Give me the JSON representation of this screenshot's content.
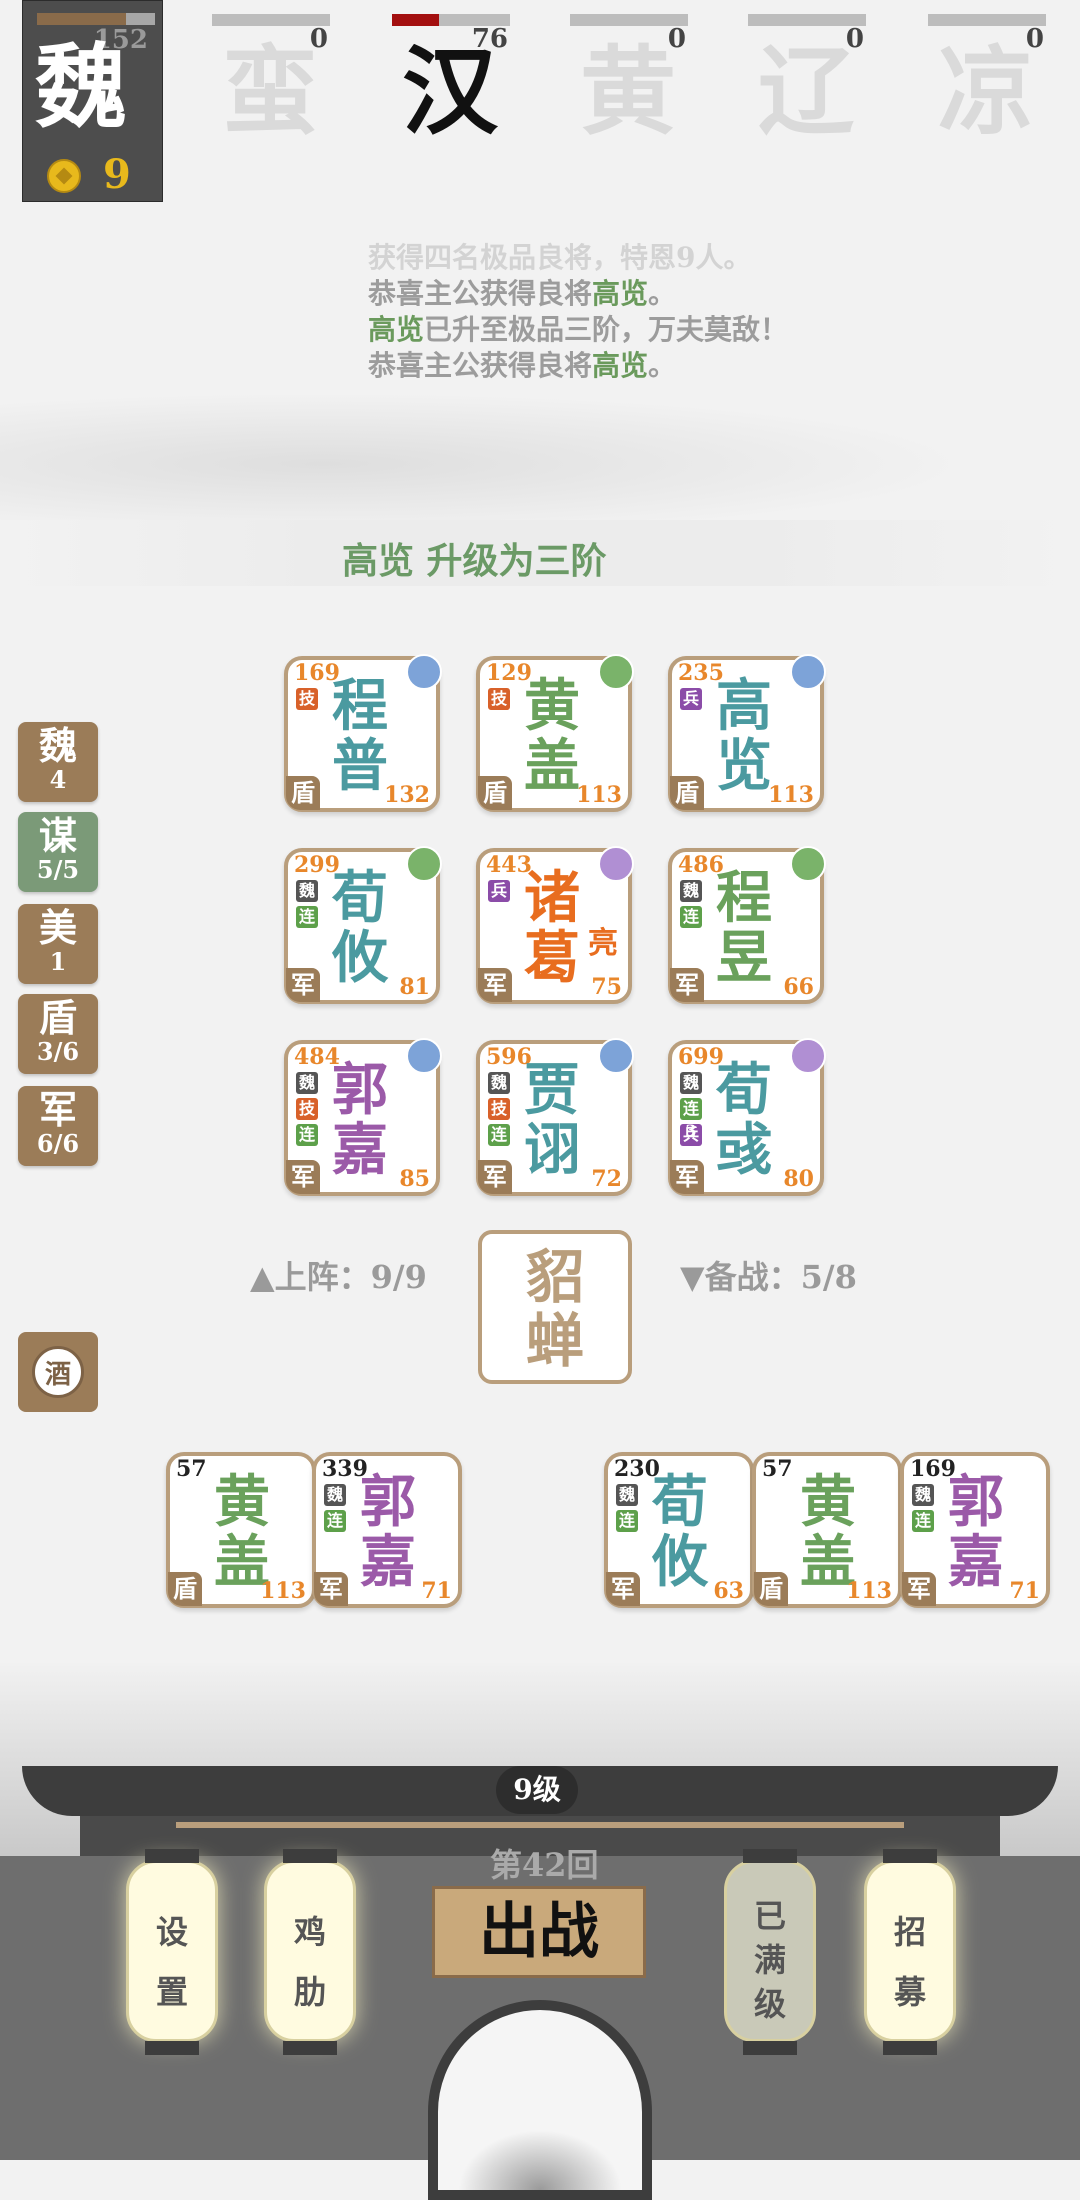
{
  "player": {
    "faction": "魏",
    "hp": "152",
    "gold": "9",
    "hp_fraction": 0.75
  },
  "rivals": [
    {
      "char": "蛮",
      "count": "0",
      "fill": 0
    },
    {
      "char": "汉",
      "count": "76",
      "fill": 0.4
    },
    {
      "char": "黄",
      "count": "0",
      "fill": 0
    },
    {
      "char": "辽",
      "count": "0",
      "fill": 0
    },
    {
      "char": "凉",
      "count": "0",
      "fill": 0
    }
  ],
  "log": {
    "line0": "获得四名极品良将，特恩9人。",
    "line1_a": "恭喜主公获得良将",
    "line1_b": "高览",
    "line1_c": "。",
    "line2_a": "高览",
    "line2_b": "已升至极品三阶，万夫莫敌！",
    "line3_a": "恭喜主公获得良将",
    "line3_b": "高览",
    "line3_c": "。"
  },
  "promotion": "高览 升级为三阶",
  "side_tabs": [
    {
      "title": "魏",
      "count": "4"
    },
    {
      "title": "谋",
      "count": "5/5"
    },
    {
      "title": "美",
      "count": "1"
    },
    {
      "title": "盾",
      "count": "3/6"
    },
    {
      "title": "军",
      "count": "6/6"
    }
  ],
  "wine_label": "酒",
  "formation": [
    {
      "n1": "程",
      "n2": "普",
      "lv": "169",
      "cls": "盾",
      "pow": "132",
      "color": "teal",
      "weapon": "blue",
      "tags": [
        "技"
      ]
    },
    {
      "n1": "黄",
      "n2": "盖",
      "lv": "129",
      "cls": "盾",
      "pow": "113",
      "color": "green",
      "weapon": "green",
      "tags": [
        "技"
      ]
    },
    {
      "n1": "高",
      "n2": "览",
      "lv": "235",
      "cls": "盾",
      "pow": "113",
      "color": "teal",
      "weapon": "blue",
      "tags": [
        "兵"
      ]
    },
    {
      "n1": "荀",
      "n2": "攸",
      "lv": "299",
      "cls": "军",
      "pow": "81",
      "color": "teal",
      "weapon": "green",
      "tags": [
        "魏",
        "连2"
      ]
    },
    {
      "n1": "诸",
      "n2": "葛",
      "sub": "亮",
      "lv": "443",
      "cls": "军",
      "pow": "75",
      "color": "orange",
      "weapon": "purple",
      "tags": [
        "兵"
      ]
    },
    {
      "n1": "程",
      "n2": "昱",
      "lv": "486",
      "cls": "军",
      "pow": "66",
      "color": "green",
      "weapon": "green",
      "tags": [
        "魏",
        "连"
      ]
    },
    {
      "n1": "郭",
      "n2": "嘉",
      "lv": "484",
      "cls": "军",
      "pow": "85",
      "color": "purple",
      "weapon": "blue",
      "tags": [
        "魏",
        "技",
        "连2"
      ]
    },
    {
      "n1": "贾",
      "n2": "诩",
      "lv": "596",
      "cls": "军",
      "pow": "72",
      "color": "teal",
      "weapon": "blue",
      "tags": [
        "魏",
        "技",
        "连"
      ]
    },
    {
      "n1": "荀",
      "n2": "彧",
      "lv": "699",
      "cls": "军",
      "pow": "80",
      "color": "teal",
      "weapon": "purple",
      "tags": [
        "魏",
        "连3",
        "兵"
      ]
    }
  ],
  "onstage": "上阵：9/9",
  "backup": "备战：5/8",
  "featured": {
    "n1": "貂",
    "n2": "蝉"
  },
  "bench": [
    {
      "n1": "黄",
      "n2": "盖",
      "lv": "57",
      "cls": "盾",
      "pow": "113",
      "color": "green",
      "tags": []
    },
    {
      "n1": "郭",
      "n2": "嘉",
      "lv": "339",
      "cls": "军",
      "pow": "71",
      "color": "purple",
      "tags": [
        "魏",
        "连"
      ]
    },
    {
      "n1": "荀",
      "n2": "攸",
      "lv": "230",
      "cls": "军",
      "pow": "63",
      "color": "teal",
      "tags": [
        "魏",
        "连"
      ]
    },
    {
      "n1": "黄",
      "n2": "盖",
      "lv": "57",
      "cls": "盾",
      "pow": "113",
      "color": "green",
      "tags": []
    },
    {
      "n1": "郭",
      "n2": "嘉",
      "lv": "169",
      "cls": "军",
      "pow": "71",
      "color": "purple",
      "tags": [
        "魏",
        "连"
      ]
    }
  ],
  "level": "9级",
  "round": "第42回",
  "fight": "出战",
  "lanterns": [
    {
      "c1": "设",
      "c2": "置",
      "c3": ""
    },
    {
      "c1": "鸡",
      "c2": "肋",
      "c3": ""
    },
    {
      "c1": "已",
      "c2": "满",
      "c3": "级"
    },
    {
      "c1": "招",
      "c2": "募",
      "c3": ""
    }
  ]
}
